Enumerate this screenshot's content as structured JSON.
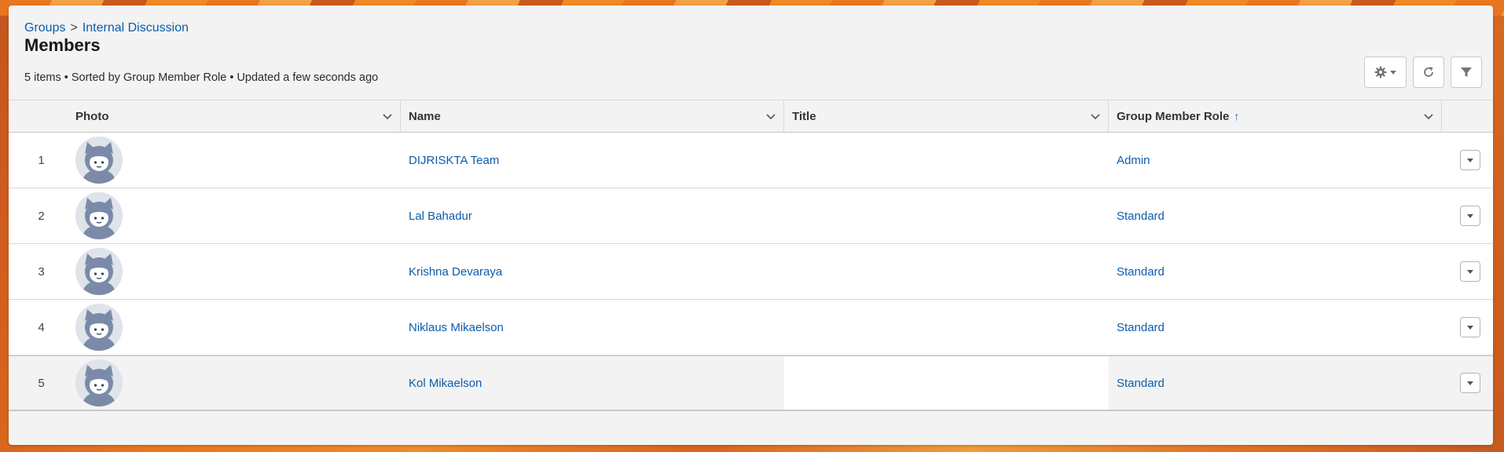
{
  "breadcrumb": {
    "root": "Groups",
    "separator": ">",
    "current": "Internal Discussion"
  },
  "page": {
    "title": "Members",
    "status": "5 items • Sorted by Group Member Role • Updated a few seconds ago"
  },
  "toolbar": {
    "settings_icon": "gear-icon",
    "refresh_icon": "refresh-icon",
    "filter_icon": "filter-icon"
  },
  "table": {
    "columns": {
      "photo": "Photo",
      "name": "Name",
      "title": "Title",
      "role": "Group Member Role",
      "role_sort": "↑"
    },
    "rows": [
      {
        "num": "1",
        "name": "DIJRISKTA Team",
        "title": "",
        "role": "Admin"
      },
      {
        "num": "2",
        "name": "Lal Bahadur",
        "title": "",
        "role": "Standard"
      },
      {
        "num": "3",
        "name": "Krishna Devaraya",
        "title": "",
        "role": "Standard"
      },
      {
        "num": "4",
        "name": "Niklaus Mikaelson",
        "title": "",
        "role": "Standard"
      },
      {
        "num": "5",
        "name": "Kol Mikaelson",
        "title": "",
        "role": "Standard"
      }
    ]
  },
  "colors": {
    "link": "#0b5cab",
    "card_bg": "#f3f3f3",
    "banner": "#e8751e"
  }
}
